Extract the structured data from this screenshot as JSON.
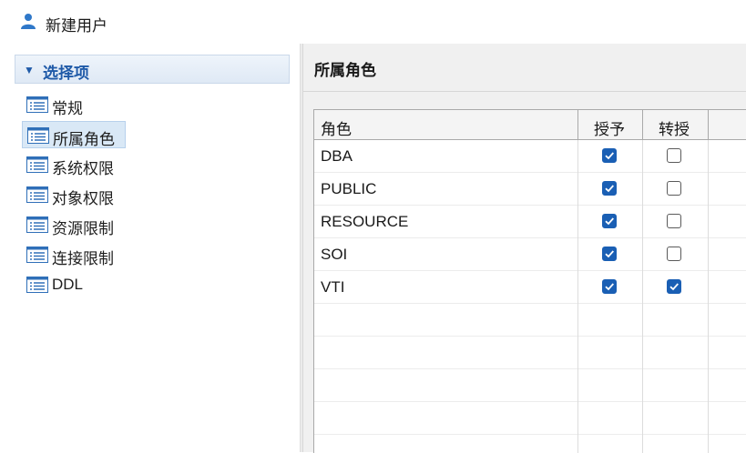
{
  "window": {
    "title": "新建用户",
    "icon": "user-icon"
  },
  "sidebar": {
    "section_title": "选择项",
    "items": [
      {
        "label": "常规",
        "icon": "list-icon",
        "selected": false
      },
      {
        "label": "所属角色",
        "icon": "list-icon",
        "selected": true
      },
      {
        "label": "系统权限",
        "icon": "list-icon",
        "selected": false
      },
      {
        "label": "对象权限",
        "icon": "list-icon",
        "selected": false
      },
      {
        "label": "资源限制",
        "icon": "list-icon",
        "selected": false
      },
      {
        "label": "连接限制",
        "icon": "list-icon",
        "selected": false
      },
      {
        "label": "DDL",
        "icon": "list-icon",
        "selected": false
      }
    ]
  },
  "main": {
    "title": "所属角色",
    "table": {
      "columns": [
        "角色",
        "授予",
        "转授"
      ],
      "rows": [
        {
          "role": "DBA",
          "grant": true,
          "delegate": false
        },
        {
          "role": "PUBLIC",
          "grant": true,
          "delegate": false
        },
        {
          "role": "RESOURCE",
          "grant": true,
          "delegate": false
        },
        {
          "role": "SOI",
          "grant": true,
          "delegate": false
        },
        {
          "role": "VTI",
          "grant": true,
          "delegate": true
        }
      ]
    }
  },
  "colors": {
    "accent": "#1a5fb4",
    "selection": "#d9e8f6",
    "header_text": "#1f5aa8"
  }
}
